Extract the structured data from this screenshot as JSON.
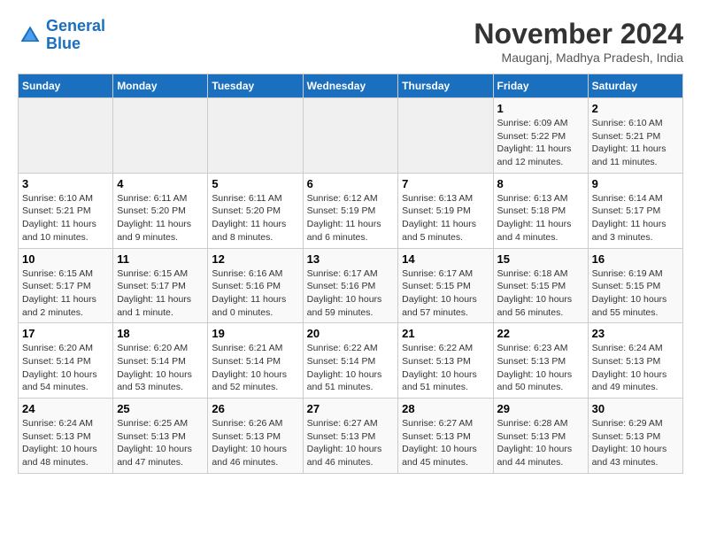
{
  "header": {
    "logo_line1": "General",
    "logo_line2": "Blue",
    "month": "November 2024",
    "location": "Mauganj, Madhya Pradesh, India"
  },
  "days_of_week": [
    "Sunday",
    "Monday",
    "Tuesday",
    "Wednesday",
    "Thursday",
    "Friday",
    "Saturday"
  ],
  "weeks": [
    [
      {
        "day": "",
        "sunrise": "",
        "sunset": "",
        "daylight": ""
      },
      {
        "day": "",
        "sunrise": "",
        "sunset": "",
        "daylight": ""
      },
      {
        "day": "",
        "sunrise": "",
        "sunset": "",
        "daylight": ""
      },
      {
        "day": "",
        "sunrise": "",
        "sunset": "",
        "daylight": ""
      },
      {
        "day": "",
        "sunrise": "",
        "sunset": "",
        "daylight": ""
      },
      {
        "day": "1",
        "sunrise": "Sunrise: 6:09 AM",
        "sunset": "Sunset: 5:22 PM",
        "daylight": "Daylight: 11 hours and 12 minutes."
      },
      {
        "day": "2",
        "sunrise": "Sunrise: 6:10 AM",
        "sunset": "Sunset: 5:21 PM",
        "daylight": "Daylight: 11 hours and 11 minutes."
      }
    ],
    [
      {
        "day": "3",
        "sunrise": "Sunrise: 6:10 AM",
        "sunset": "Sunset: 5:21 PM",
        "daylight": "Daylight: 11 hours and 10 minutes."
      },
      {
        "day": "4",
        "sunrise": "Sunrise: 6:11 AM",
        "sunset": "Sunset: 5:20 PM",
        "daylight": "Daylight: 11 hours and 9 minutes."
      },
      {
        "day": "5",
        "sunrise": "Sunrise: 6:11 AM",
        "sunset": "Sunset: 5:20 PM",
        "daylight": "Daylight: 11 hours and 8 minutes."
      },
      {
        "day": "6",
        "sunrise": "Sunrise: 6:12 AM",
        "sunset": "Sunset: 5:19 PM",
        "daylight": "Daylight: 11 hours and 6 minutes."
      },
      {
        "day": "7",
        "sunrise": "Sunrise: 6:13 AM",
        "sunset": "Sunset: 5:19 PM",
        "daylight": "Daylight: 11 hours and 5 minutes."
      },
      {
        "day": "8",
        "sunrise": "Sunrise: 6:13 AM",
        "sunset": "Sunset: 5:18 PM",
        "daylight": "Daylight: 11 hours and 4 minutes."
      },
      {
        "day": "9",
        "sunrise": "Sunrise: 6:14 AM",
        "sunset": "Sunset: 5:17 PM",
        "daylight": "Daylight: 11 hours and 3 minutes."
      }
    ],
    [
      {
        "day": "10",
        "sunrise": "Sunrise: 6:15 AM",
        "sunset": "Sunset: 5:17 PM",
        "daylight": "Daylight: 11 hours and 2 minutes."
      },
      {
        "day": "11",
        "sunrise": "Sunrise: 6:15 AM",
        "sunset": "Sunset: 5:17 PM",
        "daylight": "Daylight: 11 hours and 1 minute."
      },
      {
        "day": "12",
        "sunrise": "Sunrise: 6:16 AM",
        "sunset": "Sunset: 5:16 PM",
        "daylight": "Daylight: 11 hours and 0 minutes."
      },
      {
        "day": "13",
        "sunrise": "Sunrise: 6:17 AM",
        "sunset": "Sunset: 5:16 PM",
        "daylight": "Daylight: 10 hours and 59 minutes."
      },
      {
        "day": "14",
        "sunrise": "Sunrise: 6:17 AM",
        "sunset": "Sunset: 5:15 PM",
        "daylight": "Daylight: 10 hours and 57 minutes."
      },
      {
        "day": "15",
        "sunrise": "Sunrise: 6:18 AM",
        "sunset": "Sunset: 5:15 PM",
        "daylight": "Daylight: 10 hours and 56 minutes."
      },
      {
        "day": "16",
        "sunrise": "Sunrise: 6:19 AM",
        "sunset": "Sunset: 5:15 PM",
        "daylight": "Daylight: 10 hours and 55 minutes."
      }
    ],
    [
      {
        "day": "17",
        "sunrise": "Sunrise: 6:20 AM",
        "sunset": "Sunset: 5:14 PM",
        "daylight": "Daylight: 10 hours and 54 minutes."
      },
      {
        "day": "18",
        "sunrise": "Sunrise: 6:20 AM",
        "sunset": "Sunset: 5:14 PM",
        "daylight": "Daylight: 10 hours and 53 minutes."
      },
      {
        "day": "19",
        "sunrise": "Sunrise: 6:21 AM",
        "sunset": "Sunset: 5:14 PM",
        "daylight": "Daylight: 10 hours and 52 minutes."
      },
      {
        "day": "20",
        "sunrise": "Sunrise: 6:22 AM",
        "sunset": "Sunset: 5:14 PM",
        "daylight": "Daylight: 10 hours and 51 minutes."
      },
      {
        "day": "21",
        "sunrise": "Sunrise: 6:22 AM",
        "sunset": "Sunset: 5:13 PM",
        "daylight": "Daylight: 10 hours and 51 minutes."
      },
      {
        "day": "22",
        "sunrise": "Sunrise: 6:23 AM",
        "sunset": "Sunset: 5:13 PM",
        "daylight": "Daylight: 10 hours and 50 minutes."
      },
      {
        "day": "23",
        "sunrise": "Sunrise: 6:24 AM",
        "sunset": "Sunset: 5:13 PM",
        "daylight": "Daylight: 10 hours and 49 minutes."
      }
    ],
    [
      {
        "day": "24",
        "sunrise": "Sunrise: 6:24 AM",
        "sunset": "Sunset: 5:13 PM",
        "daylight": "Daylight: 10 hours and 48 minutes."
      },
      {
        "day": "25",
        "sunrise": "Sunrise: 6:25 AM",
        "sunset": "Sunset: 5:13 PM",
        "daylight": "Daylight: 10 hours and 47 minutes."
      },
      {
        "day": "26",
        "sunrise": "Sunrise: 6:26 AM",
        "sunset": "Sunset: 5:13 PM",
        "daylight": "Daylight: 10 hours and 46 minutes."
      },
      {
        "day": "27",
        "sunrise": "Sunrise: 6:27 AM",
        "sunset": "Sunset: 5:13 PM",
        "daylight": "Daylight: 10 hours and 46 minutes."
      },
      {
        "day": "28",
        "sunrise": "Sunrise: 6:27 AM",
        "sunset": "Sunset: 5:13 PM",
        "daylight": "Daylight: 10 hours and 45 minutes."
      },
      {
        "day": "29",
        "sunrise": "Sunrise: 6:28 AM",
        "sunset": "Sunset: 5:13 PM",
        "daylight": "Daylight: 10 hours and 44 minutes."
      },
      {
        "day": "30",
        "sunrise": "Sunrise: 6:29 AM",
        "sunset": "Sunset: 5:13 PM",
        "daylight": "Daylight: 10 hours and 43 minutes."
      }
    ]
  ]
}
